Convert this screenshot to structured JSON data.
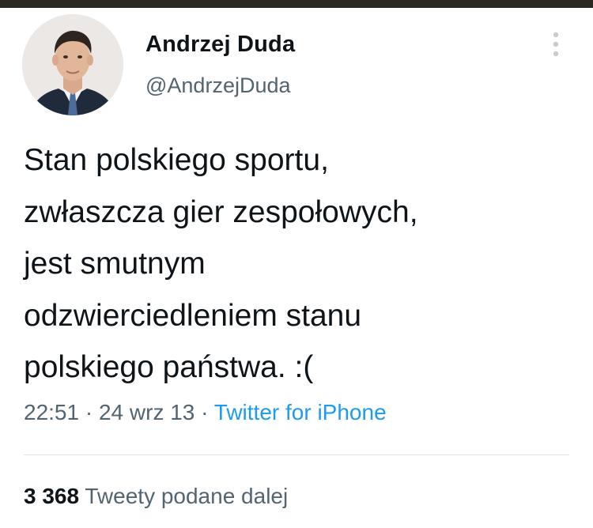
{
  "user": {
    "display_name": "Andrzej Duda",
    "handle": "@AndrzejDuda"
  },
  "tweet": {
    "text": "Stan polskiego sportu,\nzwłaszcza gier zespołowych,\njest smutnym\nodzwierciedleniem stanu\npolskiego państwa. :(",
    "time": "22:51",
    "separator1": " · ",
    "date": "24 wrz 13",
    "separator2": " · ",
    "source": "Twitter for iPhone"
  },
  "stats": {
    "retweet_count": "3 368",
    "retweet_label": "Tweety podane dalej"
  },
  "icons": {
    "more": "more-vertical-icon"
  },
  "colors": {
    "text": "#0f1419",
    "secondary": "#536471",
    "link": "#1d9bf0",
    "divider": "#dfe3e6"
  }
}
